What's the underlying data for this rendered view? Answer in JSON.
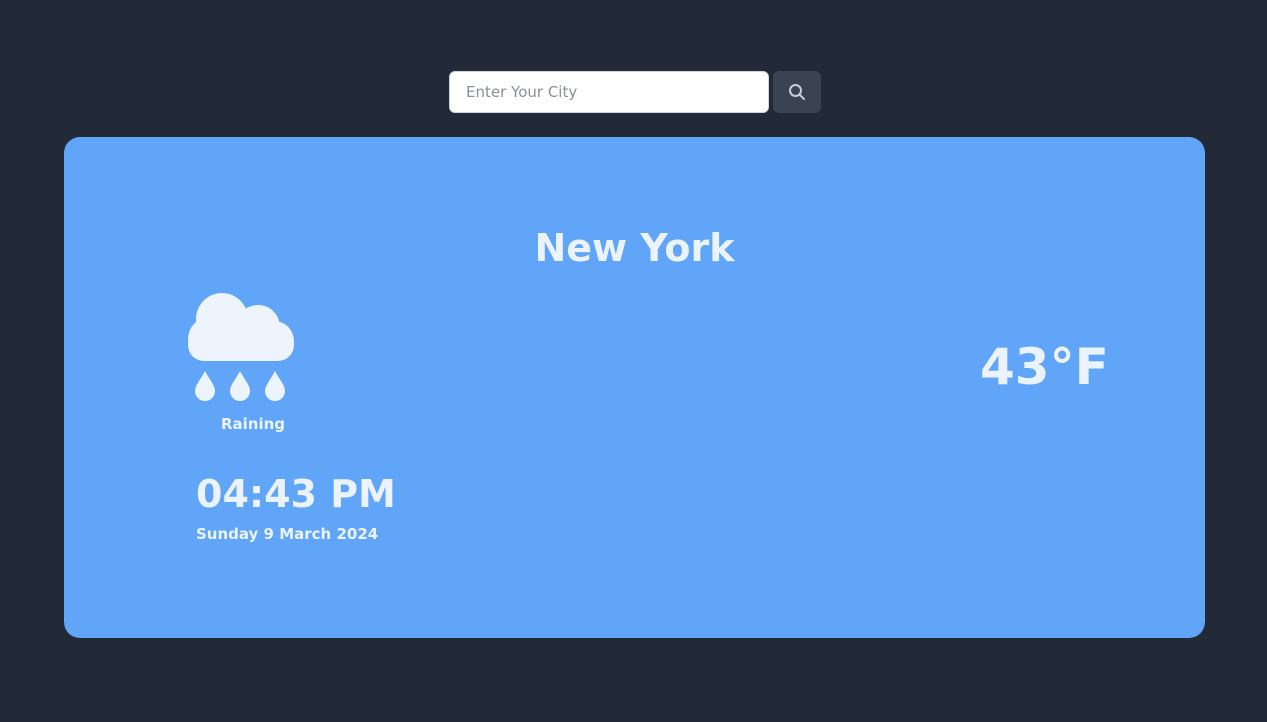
{
  "search": {
    "placeholder": "Enter Your City",
    "value": "",
    "button_icon": "search-icon"
  },
  "weather": {
    "city": "New York",
    "condition": "Raining",
    "condition_icon": "rain-cloud-icon",
    "time": "04:43 PM",
    "date": "Sunday 9 March 2024",
    "temperature": "43°F"
  },
  "colors": {
    "page_background": "#222a38",
    "card_background": "#61a5f8",
    "text": "#eaf3ff",
    "search_button": "#3a4352"
  }
}
